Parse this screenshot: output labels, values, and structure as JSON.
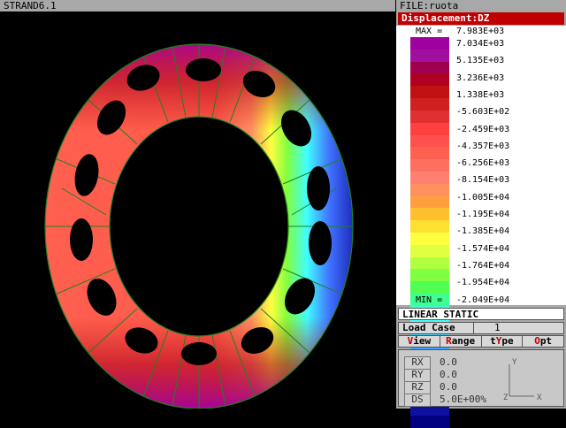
{
  "window": {
    "app_title": "STRAND6.1",
    "file_label": "FILE:ruota"
  },
  "legend": {
    "title": "Displacement:DZ",
    "max_label": "MAX =",
    "max_value": "7.983E+03",
    "min_label": "MIN =",
    "min_value": "-2.049E+04",
    "values": [
      "7.034E+03",
      "5.135E+03",
      "3.236E+03",
      "1.338E+03",
      "-5.603E+02",
      "-2.459E+03",
      "-4.357E+03",
      "-6.256E+03",
      "-8.154E+03",
      "-1.005E+04",
      "-1.195E+04",
      "-1.385E+04",
      "-1.574E+04",
      "-1.764E+04",
      "-1.954E+04"
    ],
    "colors": [
      "#a000a0",
      "#a010a0",
      "#a00050",
      "#b00020",
      "#c01010",
      "#d02020",
      "#e03030",
      "#ff4040",
      "#ff5050",
      "#ff6050",
      "#ff6f5f",
      "#ff8070",
      "#ff9060",
      "#ffa040",
      "#ffc030",
      "#ffe030",
      "#ffff40",
      "#e0ff40",
      "#b0ff40",
      "#80ff40",
      "#50ff50",
      "#40ff90",
      "#40ffd0",
      "#40ffff",
      "#40d0ff",
      "#40a0ff",
      "#4070ff",
      "#4040ff",
      "#3030e0",
      "#2020c0",
      "#1010a0",
      "#000080"
    ]
  },
  "analysis": {
    "type_label": "LINEAR STATIC",
    "load_case_label": "Load Case",
    "load_case_value": "1"
  },
  "menu": {
    "view_hot": "V",
    "view_rest": "iew",
    "range_hot": "R",
    "range_rest": "ange",
    "type_pre": "t",
    "type_hot": "Y",
    "type_rest": "pe",
    "opt_hot": "O",
    "opt_rest": "pt"
  },
  "params": {
    "rx_label": "RX",
    "rx_value": "0.0",
    "ry_label": "RY",
    "ry_value": "0.0",
    "rz_label": "RZ",
    "rz_value": "0.0",
    "ds_label": "DS",
    "ds_value": "5.0E+00%"
  },
  "axes": {
    "y": "Y",
    "z": "Z",
    "x": "X"
  }
}
